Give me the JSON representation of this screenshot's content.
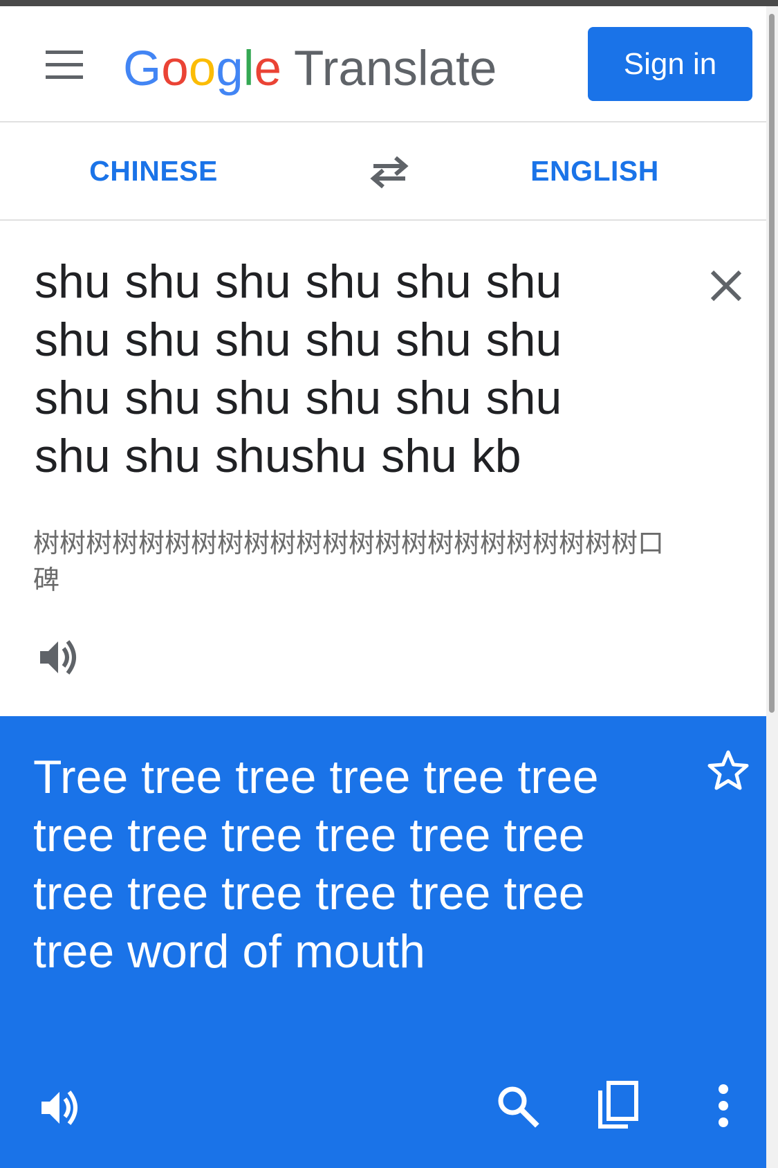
{
  "header": {
    "logo_letters": [
      {
        "char": "G",
        "color": "#4285F4"
      },
      {
        "char": "o",
        "color": "#EA4335"
      },
      {
        "char": "o",
        "color": "#FBBC05"
      },
      {
        "char": "g",
        "color": "#4285F4"
      },
      {
        "char": "l",
        "color": "#34A853"
      },
      {
        "char": "e",
        "color": "#EA4335"
      }
    ],
    "logo_brand": "Google",
    "product_name": "Translate",
    "signin_label": "Sign in",
    "menu_icon": "hamburger-menu-icon"
  },
  "languages": {
    "source": "CHINESE",
    "target": "ENGLISH",
    "swap_icon": "swap-arrows-icon"
  },
  "input": {
    "source_text": "shu shu shu shu shu shu shu shu shu shu shu shu shu shu shu shu shu shu shu shu shushu shu kb",
    "romanization": "树树树树树树树树树树树树树树树树树树树树树树树口碑",
    "clear_icon": "close-icon",
    "speak_icon": "speaker-icon"
  },
  "result": {
    "translated_text": "Tree tree tree tree tree tree tree tree tree tree tree tree tree tree tree tree tree tree tree word of mouth",
    "star_icon": "star-outline-icon",
    "speak_icon": "speaker-icon",
    "search_icon": "search-icon",
    "copy_icon": "copy-icon",
    "more_icon": "more-vertical-icon"
  },
  "colors": {
    "accent": "#1a73e8",
    "text_primary": "#202124",
    "text_secondary": "#6b6b6b",
    "icon_gray": "#5f6368"
  }
}
